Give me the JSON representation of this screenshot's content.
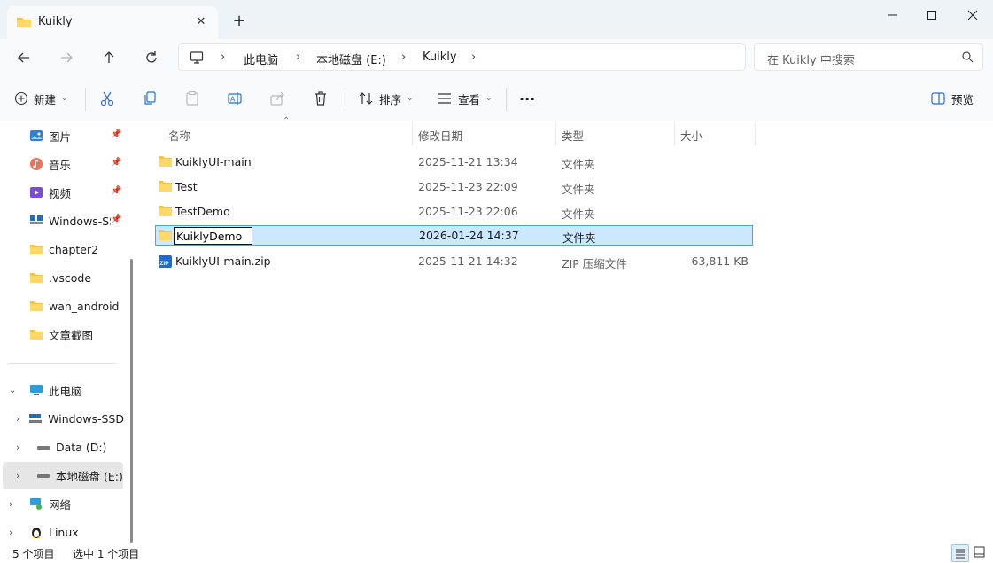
{
  "titlebar": {
    "tab_title": "Kuikly",
    "new_tab": "+",
    "close_tab": "✕"
  },
  "address": {
    "segments": [
      "此电脑",
      "本地磁盘 (E:)",
      "Kuikly"
    ],
    "search_placeholder": "在 Kuikly 中搜索"
  },
  "toolbar": {
    "new_label": "新建",
    "sort_label": "排序",
    "view_label": "查看",
    "more": "···",
    "preview_label": "预览"
  },
  "sidebar": {
    "quick": [
      {
        "label": "图片",
        "icon": "pictures-icon",
        "pinned": true
      },
      {
        "label": "音乐",
        "icon": "music-icon",
        "pinned": true
      },
      {
        "label": "视频",
        "icon": "videos-icon",
        "pinned": true
      },
      {
        "label": "Windows-SSD",
        "icon": "drive-icon",
        "pinned": true
      },
      {
        "label": "chapter2",
        "icon": "folder-icon",
        "pinned": false
      },
      {
        "label": ".vscode",
        "icon": "folder-icon",
        "pinned": false
      },
      {
        "label": "wan_android",
        "icon": "folder-icon",
        "pinned": false
      },
      {
        "label": "文章截图",
        "icon": "folder-icon",
        "pinned": false
      }
    ],
    "this_pc": "此电脑",
    "drives": [
      "Windows-SSD",
      "Data (D:)",
      "本地磁盘 (E:)"
    ],
    "network": "网络",
    "linux": "Linux"
  },
  "columns": {
    "name": "名称",
    "date": "修改日期",
    "type": "类型",
    "size": "大小"
  },
  "files": [
    {
      "name": "KuiklyUI-main",
      "date": "2025-11-21 13:34",
      "type": "文件夹",
      "size": "",
      "kind": "folder"
    },
    {
      "name": "Test",
      "date": "2025-11-23 22:09",
      "type": "文件夹",
      "size": "",
      "kind": "folder"
    },
    {
      "name": "TestDemo",
      "date": "2025-11-23 22:06",
      "type": "文件夹",
      "size": "",
      "kind": "folder"
    },
    {
      "name": "KuiklyDemo",
      "date": "2026-01-24 14:37",
      "type": "文件夹",
      "size": "",
      "kind": "folder",
      "selected": true,
      "renaming": true
    },
    {
      "name": "KuiklyUI-main.zip",
      "date": "2025-11-21 14:32",
      "type": "ZIP 压缩文件",
      "size": "63,811 KB",
      "kind": "zip"
    }
  ],
  "status": {
    "count": "5 个项目",
    "selected": "选中 1 个项目"
  },
  "colors": {
    "folder": "#f4c542",
    "selection": "#cce8ff",
    "selection_border": "#4da3e0",
    "accent": "#0067c0"
  }
}
